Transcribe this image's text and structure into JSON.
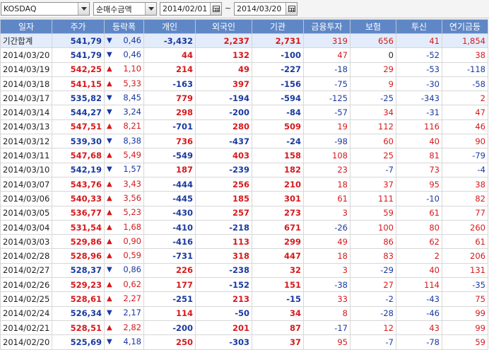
{
  "filter": {
    "market": "KOSDAQ",
    "metric": "순매수금액",
    "start_date": "2014/02/01",
    "range_separator": "~",
    "end_date": "2014/03/20"
  },
  "columns": [
    "일자",
    "주가",
    "등락폭",
    "개인",
    "외국인",
    "기관",
    "금융투자",
    "보험",
    "투신",
    "연기금등"
  ],
  "colors": {
    "header": "#5f87c6",
    "up": "#d7191c",
    "down": "#1a3aa0",
    "total_row": "#e3ecfa"
  },
  "rows": [
    {
      "date": "기간합계",
      "price": "541,79",
      "dir": "down",
      "change": "0,46",
      "indiv": "-3,432",
      "foreign": "2,237",
      "inst": "2,731",
      "fin": "319",
      "ins": "656",
      "trust": "41",
      "pension": "1,854"
    },
    {
      "date": "2014/03/20",
      "price": "541,79",
      "dir": "down",
      "change": "0,46",
      "indiv": "44",
      "foreign": "132",
      "inst": "-100",
      "fin": "47",
      "ins": "0",
      "trust": "-52",
      "pension": "38"
    },
    {
      "date": "2014/03/19",
      "price": "542,25",
      "dir": "up",
      "change": "1,10",
      "indiv": "214",
      "foreign": "49",
      "inst": "-227",
      "fin": "-18",
      "ins": "29",
      "trust": "-53",
      "pension": "-118"
    },
    {
      "date": "2014/03/18",
      "price": "541,15",
      "dir": "up",
      "change": "5,33",
      "indiv": "-163",
      "foreign": "397",
      "inst": "-156",
      "fin": "-75",
      "ins": "9",
      "trust": "-30",
      "pension": "-58"
    },
    {
      "date": "2014/03/17",
      "price": "535,82",
      "dir": "down",
      "change": "8,45",
      "indiv": "779",
      "foreign": "-194",
      "inst": "-594",
      "fin": "-125",
      "ins": "-25",
      "trust": "-343",
      "pension": "2"
    },
    {
      "date": "2014/03/14",
      "price": "544,27",
      "dir": "down",
      "change": "3,24",
      "indiv": "298",
      "foreign": "-200",
      "inst": "-84",
      "fin": "-57",
      "ins": "34",
      "trust": "-31",
      "pension": "47"
    },
    {
      "date": "2014/03/13",
      "price": "547,51",
      "dir": "up",
      "change": "8,21",
      "indiv": "-701",
      "foreign": "280",
      "inst": "509",
      "fin": "19",
      "ins": "112",
      "trust": "116",
      "pension": "46"
    },
    {
      "date": "2014/03/12",
      "price": "539,30",
      "dir": "down",
      "change": "8,38",
      "indiv": "736",
      "foreign": "-437",
      "inst": "-24",
      "fin": "-98",
      "ins": "60",
      "trust": "40",
      "pension": "90"
    },
    {
      "date": "2014/03/11",
      "price": "547,68",
      "dir": "up",
      "change": "5,49",
      "indiv": "-549",
      "foreign": "403",
      "inst": "158",
      "fin": "108",
      "ins": "25",
      "trust": "81",
      "pension": "-79"
    },
    {
      "date": "2014/03/10",
      "price": "542,19",
      "dir": "down",
      "change": "1,57",
      "indiv": "187",
      "foreign": "-239",
      "inst": "182",
      "fin": "23",
      "ins": "-7",
      "trust": "73",
      "pension": "-4"
    },
    {
      "date": "2014/03/07",
      "price": "543,76",
      "dir": "up",
      "change": "3,43",
      "indiv": "-444",
      "foreign": "256",
      "inst": "210",
      "fin": "18",
      "ins": "37",
      "trust": "95",
      "pension": "38"
    },
    {
      "date": "2014/03/06",
      "price": "540,33",
      "dir": "up",
      "change": "3,56",
      "indiv": "-445",
      "foreign": "185",
      "inst": "301",
      "fin": "61",
      "ins": "111",
      "trust": "-10",
      "pension": "82"
    },
    {
      "date": "2014/03/05",
      "price": "536,77",
      "dir": "up",
      "change": "5,23",
      "indiv": "-430",
      "foreign": "257",
      "inst": "273",
      "fin": "3",
      "ins": "59",
      "trust": "61",
      "pension": "77"
    },
    {
      "date": "2014/03/04",
      "price": "531,54",
      "dir": "up",
      "change": "1,68",
      "indiv": "-410",
      "foreign": "-218",
      "inst": "671",
      "fin": "-26",
      "ins": "100",
      "trust": "80",
      "pension": "260"
    },
    {
      "date": "2014/03/03",
      "price": "529,86",
      "dir": "up",
      "change": "0,90",
      "indiv": "-416",
      "foreign": "113",
      "inst": "299",
      "fin": "49",
      "ins": "86",
      "trust": "62",
      "pension": "61"
    },
    {
      "date": "2014/02/28",
      "price": "528,96",
      "dir": "up",
      "change": "0,59",
      "indiv": "-731",
      "foreign": "318",
      "inst": "447",
      "fin": "18",
      "ins": "83",
      "trust": "2",
      "pension": "206"
    },
    {
      "date": "2014/02/27",
      "price": "528,37",
      "dir": "down",
      "change": "0,86",
      "indiv": "226",
      "foreign": "-238",
      "inst": "32",
      "fin": "3",
      "ins": "-29",
      "trust": "40",
      "pension": "131"
    },
    {
      "date": "2014/02/26",
      "price": "529,23",
      "dir": "up",
      "change": "0,62",
      "indiv": "177",
      "foreign": "-152",
      "inst": "151",
      "fin": "-38",
      "ins": "27",
      "trust": "114",
      "pension": "-35"
    },
    {
      "date": "2014/02/25",
      "price": "528,61",
      "dir": "up",
      "change": "2,27",
      "indiv": "-251",
      "foreign": "213",
      "inst": "-15",
      "fin": "33",
      "ins": "-2",
      "trust": "-43",
      "pension": "75"
    },
    {
      "date": "2014/02/24",
      "price": "526,34",
      "dir": "down",
      "change": "2,17",
      "indiv": "114",
      "foreign": "-50",
      "inst": "34",
      "fin": "8",
      "ins": "-28",
      "trust": "-46",
      "pension": "99"
    },
    {
      "date": "2014/02/21",
      "price": "528,51",
      "dir": "up",
      "change": "2,82",
      "indiv": "-200",
      "foreign": "201",
      "inst": "87",
      "fin": "-17",
      "ins": "12",
      "trust": "43",
      "pension": "99"
    },
    {
      "date": "2014/02/20",
      "price": "525,69",
      "dir": "down",
      "change": "4,18",
      "indiv": "250",
      "foreign": "-303",
      "inst": "37",
      "fin": "95",
      "ins": "-7",
      "trust": "-78",
      "pension": "59"
    }
  ]
}
